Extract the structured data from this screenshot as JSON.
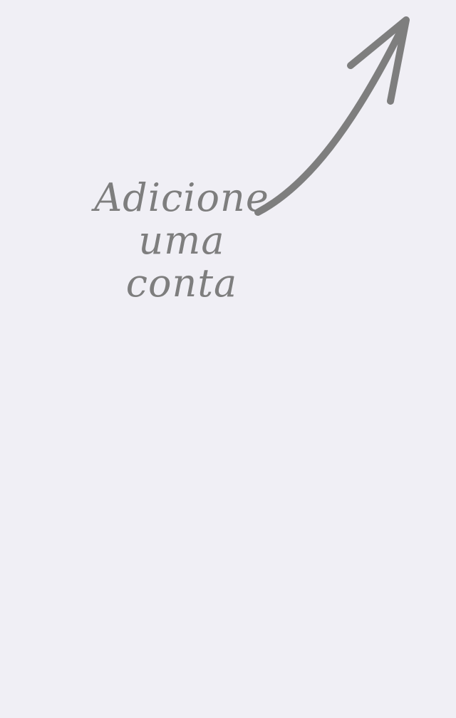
{
  "empty_state": {
    "hint_line_1": "Adicione",
    "hint_line_2": "uma conta",
    "hint_color": "#7E7E7E",
    "arrow_icon": "curved-arrow-up-right-icon"
  },
  "background_color": "#F0EFF5"
}
